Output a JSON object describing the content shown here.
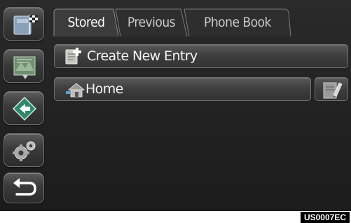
{
  "tabs": [
    {
      "label": "Stored",
      "active": true
    },
    {
      "label": "Previous",
      "active": false
    },
    {
      "label": "Phone Book",
      "active": false
    }
  ],
  "sidebar": {
    "items": [
      {
        "icon": "destination-flag-icon"
      },
      {
        "icon": "map-info-icon"
      },
      {
        "icon": "route-arrow-icon"
      },
      {
        "icon": "settings-gears-icon"
      },
      {
        "icon": "back-arrow-icon"
      }
    ]
  },
  "list": {
    "create_label": "Create New Entry",
    "create_icon": "notepad-plus-icon",
    "home_label": "Home",
    "home_icon": "home-icon",
    "edit_icon": "pencil-edit-icon"
  },
  "footer": {
    "code": "US0007EC"
  },
  "colors": {
    "background": "#222222",
    "button": "#444444",
    "text": "#f0f0f0"
  }
}
